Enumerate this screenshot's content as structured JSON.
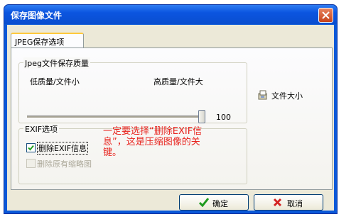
{
  "window": {
    "title": "保存图像文件"
  },
  "tabs": [
    {
      "label": "JPEG保存选项"
    }
  ],
  "quality": {
    "group_label": "Jpeg文件保存质量",
    "low_label": "低质量/文件小",
    "high_label": "高质量/文件大",
    "value": "100",
    "slider_fraction": 1.0
  },
  "file_size": {
    "label": "文件大小",
    "icon": "disk-file-icon"
  },
  "exif": {
    "group_label": "EXIF选项",
    "remove_exif": {
      "label": "删除EXIF信息",
      "checked": true
    },
    "remove_thumbnail": {
      "label": "删除原有缩略图",
      "checked": false,
      "enabled": false
    }
  },
  "annotation": {
    "line1": "一定要选择“删除EXIF信",
    "line2": "息”，这是压缩图像的关",
    "line3": "键。",
    "color": "#e8231d"
  },
  "buttons": {
    "ok": {
      "label": "确定",
      "icon": "check-icon"
    },
    "cancel": {
      "label": "取消",
      "icon": "x-icon"
    }
  }
}
